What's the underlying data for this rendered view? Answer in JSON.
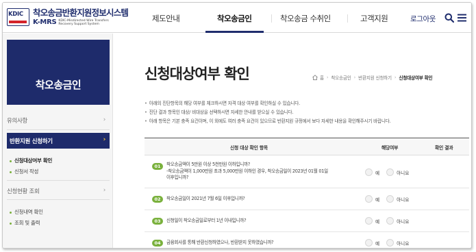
{
  "logo": {
    "mark": "KDIC",
    "title": "착오송금반환지원정보시스템",
    "kmrs": "K-MRS",
    "eng": "KDIC-Misdirected Wire Transfers Recovery Support System"
  },
  "gnb": {
    "items": [
      "제도안내",
      "착오송금인",
      "착오송금 수취인",
      "고객지원"
    ],
    "active": "착오송금인",
    "logout": "로그아웃"
  },
  "icons": {
    "search": "search-icon",
    "menu": "menu-icon",
    "home": "home-icon"
  },
  "sidebar": {
    "title": "착오송금인",
    "menu1": "유의사항",
    "menu2": "반환지원 신청하기",
    "sub1": "신청대상여부 확인",
    "sub2": "신청서 작성",
    "menu3": "신청현황 조회",
    "sub3": "신청내역 확인",
    "sub4": "조회 및 출력",
    "chevron": "›"
  },
  "main": {
    "title": "신청대상여부 확인",
    "breadcrumb": [
      "홈",
      "착오송금인",
      "반환지원 신청하기",
      "신청대상여부 확인"
    ],
    "notes": [
      "아래의 진단항목의 해당 여부를 체크하시면 자격 대상 여부를 확인하실 수 있습니다.",
      "진단 결과 항목인 대상/ 비대상을 선택하시면 자세한 안내를 받으실 수 있습니다.",
      "아래 항목은 기본 충족 요건이며, 이 외에도 여러 충족 요건이 있으므로 반환지원 규정에서 보다 자세한 내용을 확인해주시기 바랍니다."
    ],
    "table": {
      "headers": [
        "신청 대상 확인 항목",
        "해당여부",
        "확인 결과"
      ],
      "yes": "예",
      "no": "아니요",
      "rows": [
        {
          "num": "01",
          "line1": "착오송금액이 5만원 이상 5천만원 이하입니까?",
          "line2": "-착오송금액이 1,000만원 초과 5,000만원 이하인 경우, 착오송금일이 2023년 01월 01일",
          "line3": "이후입니까?"
        },
        {
          "num": "02",
          "line1": "착오송금일이 2021년 7월 6일 이후입니까?"
        },
        {
          "num": "03",
          "line1": "신청일이 착오송금일로부터 1년 이내입니까?"
        },
        {
          "num": "04",
          "line1": "금융회사를 통해 반환신청하였으나, 반환받지 못하였습니까?"
        }
      ]
    }
  }
}
